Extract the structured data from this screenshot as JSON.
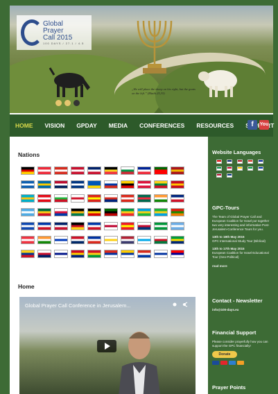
{
  "logo": {
    "title_line1": "Global",
    "title_line2": "Prayer",
    "title_line3": "Call 2015",
    "subline": "100 DAYS / 27.1 / 4.5"
  },
  "banner": {
    "quote": "„He will place the sheep on his right, but the goats on the left.” (Matth.25,33)",
    "slider_dots": 3
  },
  "nav": {
    "items": [
      "HOME",
      "VISION",
      "GPDAY",
      "MEDIA",
      "CONFERENCES",
      "RESOURCES",
      "SUPPORT"
    ],
    "active_index": 0,
    "social": {
      "facebook": "f",
      "youtube": "You"
    }
  },
  "main": {
    "nations_title": "Nations",
    "home_title": "Home",
    "video_title": "Global Prayer Call Conference in Jerusalem..."
  },
  "flags": [
    [
      "#000000",
      "#dd0000",
      "#ffce00"
    ],
    [
      "#ed2939",
      "#ffffff",
      "#ed2939"
    ],
    [
      "#d52b1e",
      "#ffffff",
      "#d52b1e"
    ],
    [
      "#c8102e",
      "#ffffff",
      "#c8102e"
    ],
    [
      "#012169",
      "#ffffff",
      "#c8102e"
    ],
    [
      "#000000",
      "#fdda24",
      "#ef3340"
    ],
    [
      "#ffffff",
      "#009246",
      "#ce2b37"
    ],
    [
      "#002395",
      "#ffffff",
      "#ed2939"
    ],
    [
      "#006600",
      "#ff0000",
      "#ff0000"
    ],
    [
      "#aa151b",
      "#f1bf00",
      "#aa151b"
    ],
    [
      "#0d5eaf",
      "#ffffff",
      "#0d5eaf"
    ],
    [
      "#006aa7",
      "#fecc00",
      "#006aa7"
    ],
    [
      "#ba0c2f",
      "#ffffff",
      "#00205b"
    ],
    [
      "#003580",
      "#ffffff",
      "#003580"
    ],
    [
      "#0057b7",
      "#0057b7",
      "#ffd700"
    ],
    [
      "#ffffff",
      "#0039a6",
      "#d52b1e"
    ],
    [
      "#ffce00",
      "#000000",
      "#dd0000"
    ],
    [
      "#dc143c",
      "#ffffff",
      "#dc143c"
    ],
    [
      "#fcd116",
      "#00843d",
      "#ce1126"
    ],
    [
      "#c60b1e",
      "#ffc400",
      "#c60b1e"
    ],
    [
      "#00afca",
      "#fec50c",
      "#00afca"
    ],
    [
      "#e30a17",
      "#ffffff",
      "#e30a17"
    ],
    [
      "#ffffff",
      "#1eb53a",
      "#ce1126"
    ],
    [
      "#ffffff",
      "#cf142b",
      "#ffffff"
    ],
    [
      "#da251d",
      "#ffff00",
      "#da251d"
    ],
    [
      "#ffffff",
      "#d52b1e",
      "#00247d"
    ],
    [
      "#da291c",
      "#ffffff",
      "#da291c"
    ],
    [
      "#006a4e",
      "#f42a41",
      "#006a4e"
    ],
    [
      "#ff9933",
      "#ffffff",
      "#138808"
    ],
    [
      "#00247d",
      "#ffffff",
      "#cf142b"
    ],
    [
      "#4fabe4",
      "#ffffff",
      "#4fabe4"
    ],
    [
      "#006b3f",
      "#fcd116",
      "#ce1126"
    ],
    [
      "#ffffff",
      "#dc143c",
      "#0038a8"
    ],
    [
      "#000000",
      "#ffb612",
      "#007a4d"
    ],
    [
      "#000000",
      "#fcdc04",
      "#d90000"
    ],
    [
      "#006600",
      "#000000",
      "#bb0000"
    ],
    [
      "#009a44",
      "#fcd116",
      "#ef2b2d"
    ],
    [
      "#00a3dd",
      "#fcd116",
      "#1eb53a"
    ],
    [
      "#1eb53a",
      "#fcd116",
      "#00a3dd"
    ],
    [
      "#de2010",
      "#198a00",
      "#ef7d00"
    ],
    [
      "#0f47af",
      "#ffffff",
      "#0f47af"
    ],
    [
      "#0038a8",
      "#ffffff",
      "#ce1126"
    ],
    [
      "#012169",
      "#ffffff",
      "#c8102e"
    ],
    [
      "#000000",
      "#ce1126",
      "#fcd116"
    ],
    [
      "#0038a8",
      "#ffffff",
      "#ce1126"
    ],
    [
      "#ffffff",
      "#bc002d",
      "#ffffff"
    ],
    [
      "#ee1c25",
      "#ffff00",
      "#ee1c25"
    ],
    [
      "#ffffff",
      "#c60c30",
      "#003478"
    ],
    [
      "#009639",
      "#ffffff",
      "#009639"
    ],
    [
      "#6cace4",
      "#ffffff",
      "#6cace4"
    ],
    [
      "#ef3340",
      "#ffffff",
      "#ef3340"
    ],
    [
      "#ff9933",
      "#ffffff",
      "#138808"
    ],
    [
      "#ffffff",
      "#0038b8",
      "#ffffff"
    ],
    [
      "#ce1126",
      "#ffffff",
      "#002868"
    ],
    [
      "#0032a0",
      "#ffffff",
      "#da291c"
    ],
    [
      "#ffffff",
      "#fcd116",
      "#ffffff"
    ],
    [
      "#b22234",
      "#ffffff",
      "#3c3b6e"
    ],
    [
      "#ffffff",
      "#00a8e8",
      "#ffffff"
    ],
    [
      "#ffffff",
      "#ce1126",
      "#007a3d"
    ],
    [
      "#009c3b",
      "#ffdf00",
      "#002776"
    ],
    [
      "#fcd116",
      "#003893",
      "#ce1126"
    ],
    [
      "#ffffff",
      "#c8102e",
      "#012169"
    ],
    [
      "#ffffff",
      "#001489",
      "#ffffff"
    ],
    [
      "#cf0921",
      "#ffd100",
      "#00247d"
    ],
    [
      "#ce1126",
      "#fcd116",
      "#009739"
    ],
    [
      "#da291c",
      "#0032a0",
      "#ffffff"
    ],
    [
      "#ffcd00",
      "#0032a0",
      "#ffffff"
    ],
    [
      "#d52b1e",
      "#ffffff",
      "#0039a6"
    ],
    [
      "#ffffff",
      "#0032a0",
      "#ffffff"
    ],
    [
      "#fe0000",
      "#000095",
      "#ffffff"
    ]
  ],
  "sidebar": {
    "languages_title": "Website Languages",
    "lang_flags": [
      "#dd0000",
      "#012169",
      "#aa151b",
      "#d52b1e",
      "#002395",
      "#009246",
      "#c60c30",
      "#ffce00",
      "#009639",
      "#0039a6",
      "#ba0c2f",
      "#003580"
    ],
    "tours_title": "GPC-Tours",
    "tours_text": "The Team of Global Prayer Call and European Coalition for Israel put together two very interesting and informative Post-Jerusalem-Conference Tours for you.",
    "tour1_date": "13th to 18th May 2015",
    "tour1_text": "GPC International Study Tour (Biblical)",
    "tour2_date": "13th to 17th May 2015",
    "tour2_text": "European Coalition for Israel Educational Tour (Geo-Political)",
    "read_more": "read more",
    "contact_title": "Contact - Newsletter",
    "contact_email": "info@100-days.eu",
    "financial_title": "Financial Support",
    "financial_text": "Please consider prayerfully how you can support the GPC financially!",
    "donate_label": "Donate",
    "prayer_title": "Prayer Points"
  }
}
